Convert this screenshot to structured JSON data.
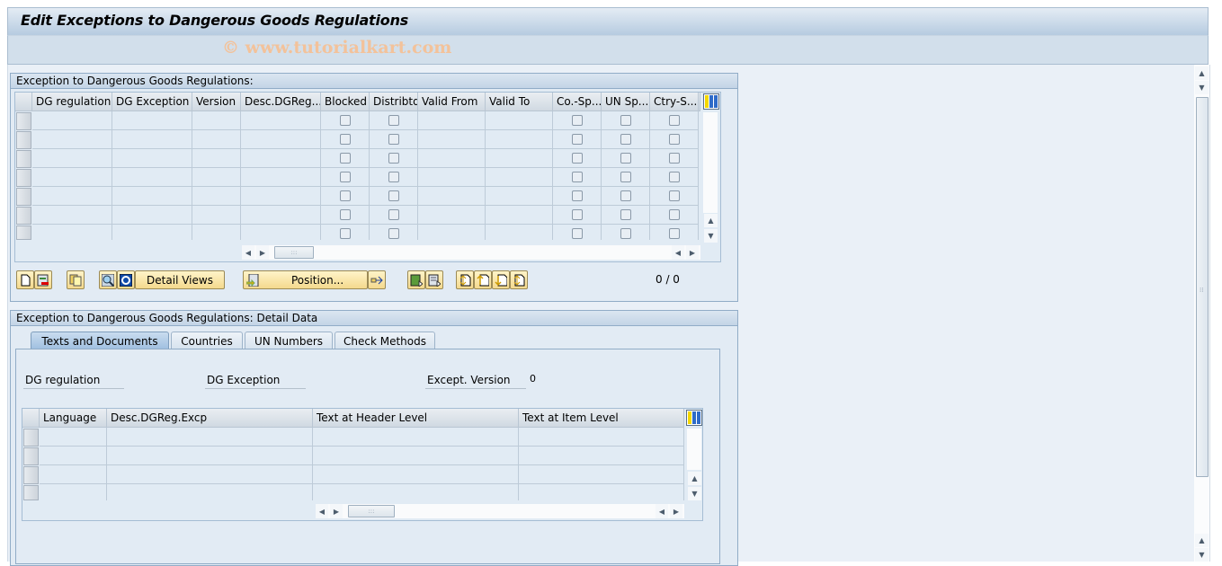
{
  "window": {
    "title": "Edit Exceptions to Dangerous Goods Regulations",
    "watermark": "© www.tutorialkart.com"
  },
  "overview": {
    "heading": "Exception to Dangerous Goods Regulations:",
    "columns": [
      {
        "label": "DG regulation",
        "type": "text"
      },
      {
        "label": "DG Exception",
        "type": "text"
      },
      {
        "label": "Version",
        "type": "text"
      },
      {
        "label": "Desc.DGReg....",
        "type": "text"
      },
      {
        "label": "Blocked",
        "type": "checkbox"
      },
      {
        "label": "Distribtd",
        "type": "checkbox"
      },
      {
        "label": "Valid From",
        "type": "text"
      },
      {
        "label": "Valid To",
        "type": "text"
      },
      {
        "label": "Co.-Sp...",
        "type": "checkbox"
      },
      {
        "label": "UN Sp...",
        "type": "checkbox"
      },
      {
        "label": "Ctry-S...",
        "type": "checkbox"
      }
    ],
    "row_count": 7,
    "toolbar": {
      "detail_views_label": "Detail Views",
      "position_label": "Position...",
      "icons": [
        "new-entry-icon",
        "delete-entry-icon",
        "copy-entry-icon",
        "find-icon",
        "refresh-icon",
        "position-icon",
        "navigate-icon",
        "select-all-icon",
        "deselect-all-icon",
        "first-page-icon",
        "previous-page-icon",
        "next-page-icon",
        "last-page-icon"
      ],
      "counter": "0 / 0"
    }
  },
  "detail": {
    "heading": "Exception to Dangerous Goods Regulations: Detail Data",
    "tabs": [
      {
        "label": "Texts and Documents",
        "active": true
      },
      {
        "label": "Countries",
        "active": false
      },
      {
        "label": "UN Numbers",
        "active": false
      },
      {
        "label": "Check Methods",
        "active": false
      }
    ],
    "fields": {
      "dg_regulation_label": "DG regulation",
      "dg_exception_label": "DG Exception",
      "except_version_label": "Except. Version",
      "except_version_value": "0"
    },
    "texts_table": {
      "columns": [
        "Language",
        "Desc.DGReg.Excp",
        "Text at Header Level",
        "Text at Item Level"
      ],
      "row_count": 4
    }
  },
  "colors": {
    "toolbar_button": "#f4d98d",
    "panel_bg": "#e2ebf4",
    "header_bg": "#b6cbe0"
  }
}
